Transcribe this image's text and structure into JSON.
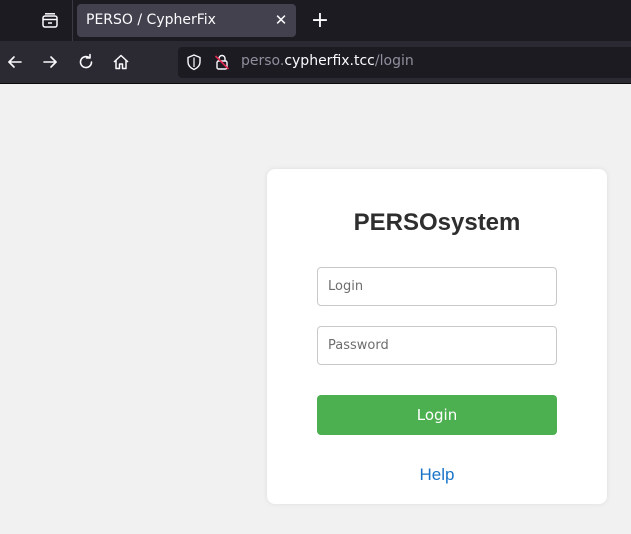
{
  "browser": {
    "tab": {
      "title": "PERSO / CypherFix",
      "close_glyph": "✕"
    },
    "new_tab_glyph": "+",
    "url": {
      "prefix": "perso.",
      "host": "cypherfix.tcc",
      "path": "/login"
    },
    "icons": [
      "tab-list-icon",
      "back-arrow-icon",
      "forward-arrow-icon",
      "reload-icon",
      "home-icon",
      "tracking-shield-icon",
      "insecure-lock-icon"
    ]
  },
  "login_card": {
    "title": "PERSOsystem",
    "login_placeholder": "Login",
    "password_placeholder": "Password",
    "submit_label": "Login",
    "help_label": "Help"
  },
  "colors": {
    "submit": "#4caf50",
    "link": "#1a73c8",
    "page_bg": "#f1f1f1"
  }
}
